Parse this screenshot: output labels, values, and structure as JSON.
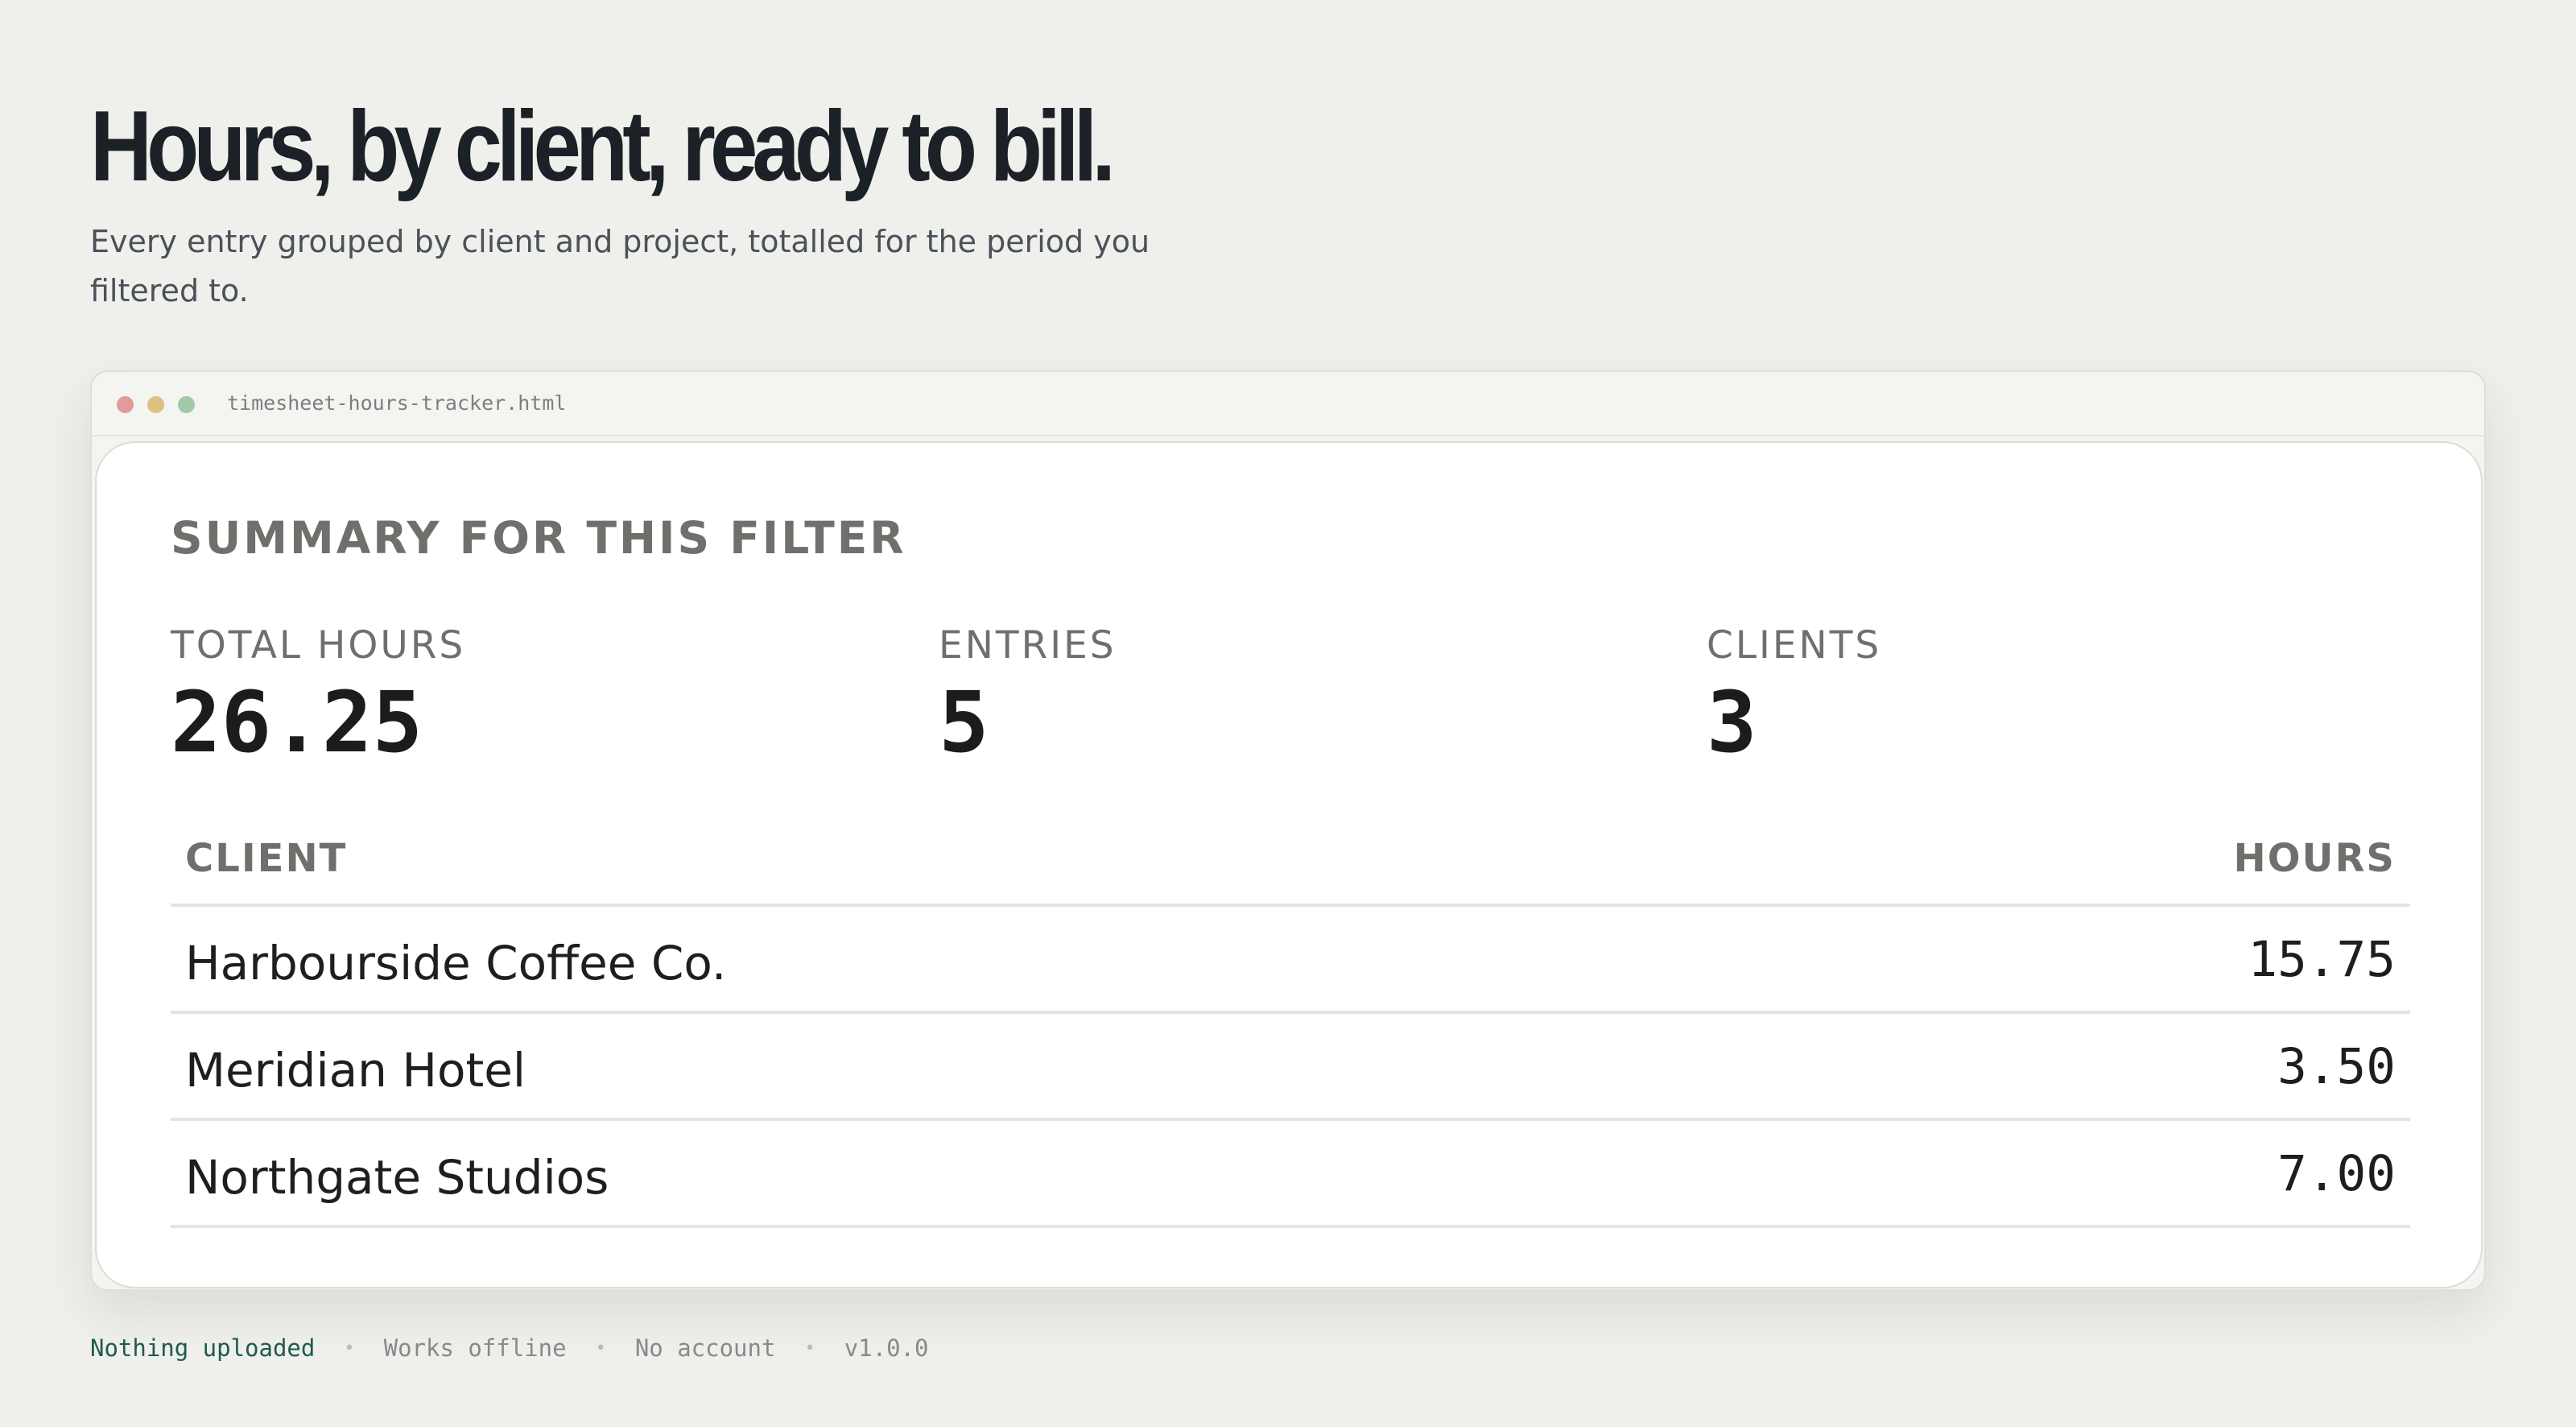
{
  "hero": {
    "title": "Hours, by client, ready to bill.",
    "subtitle": "Every entry grouped by client and project, totalled for the period you filtered to."
  },
  "window": {
    "filename": "timesheet-hours-tracker.html",
    "controls": [
      "close",
      "minimize",
      "maximize"
    ]
  },
  "summary": {
    "title": "SUMMARY FOR THIS FILTER",
    "stats": [
      {
        "label": "TOTAL HOURS",
        "value": "26.25"
      },
      {
        "label": "ENTRIES",
        "value": "5"
      },
      {
        "label": "CLIENTS",
        "value": "3"
      }
    ],
    "table": {
      "headers": {
        "client": "CLIENT",
        "hours": "HOURS"
      },
      "rows": [
        {
          "client": "Harbourside Coffee Co.",
          "hours": "15.75"
        },
        {
          "client": "Meridian Hotel",
          "hours": "3.50"
        },
        {
          "client": "Northgate Studios",
          "hours": "7.00"
        }
      ]
    }
  },
  "footer": {
    "items": [
      "Nothing uploaded",
      "Works offline",
      "No account",
      "v1.0.0"
    ],
    "separator": "•"
  },
  "colors": {
    "background": "#eff0ec",
    "card": "#ffffff",
    "accent": "#1e5a50",
    "dot_red": "#e09c98",
    "dot_yellow": "#dcc280",
    "dot_green": "#a2c9a8"
  }
}
